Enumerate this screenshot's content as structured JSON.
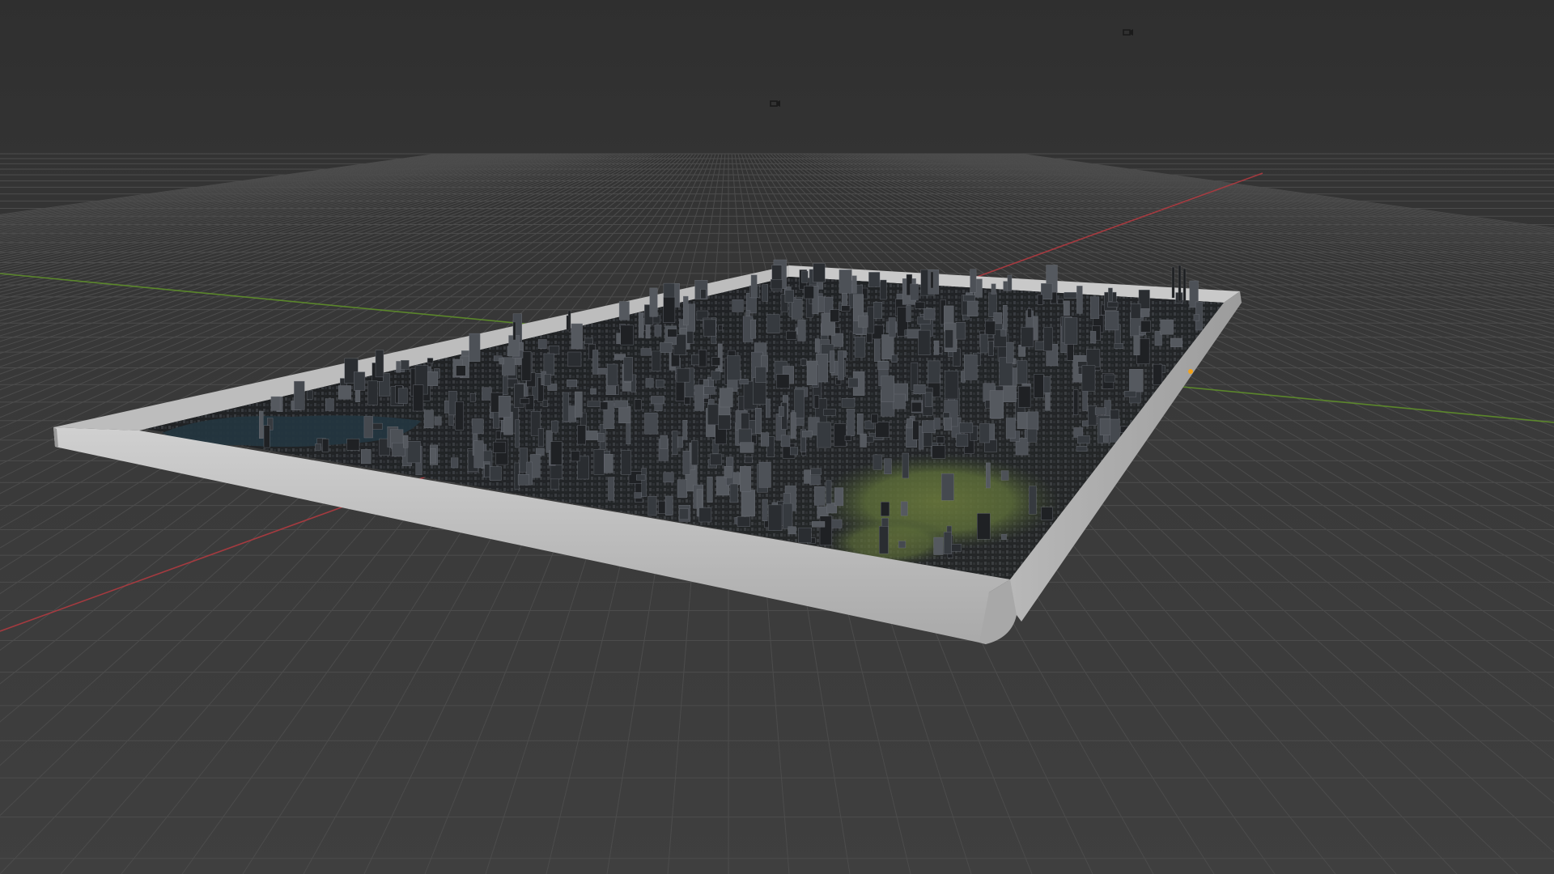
{
  "viewport": {
    "type": "3d-viewport",
    "shading": "solid-wireframe",
    "background_color": "#3d3d3d",
    "grid_color": "#4c4c4c",
    "x_axis_color": "#c0393f",
    "y_axis_color": "#6a9a2c"
  },
  "scene_objects": [
    {
      "name": "city-model",
      "kind": "terrain-mesh-with-buildings",
      "frame_color": "#b9b9b9"
    },
    {
      "name": "camera-1",
      "kind": "camera-icon"
    },
    {
      "name": "camera-2",
      "kind": "camera-icon"
    },
    {
      "name": "origin-point",
      "kind": "origin-marker",
      "color": "#f2a21a"
    }
  ]
}
